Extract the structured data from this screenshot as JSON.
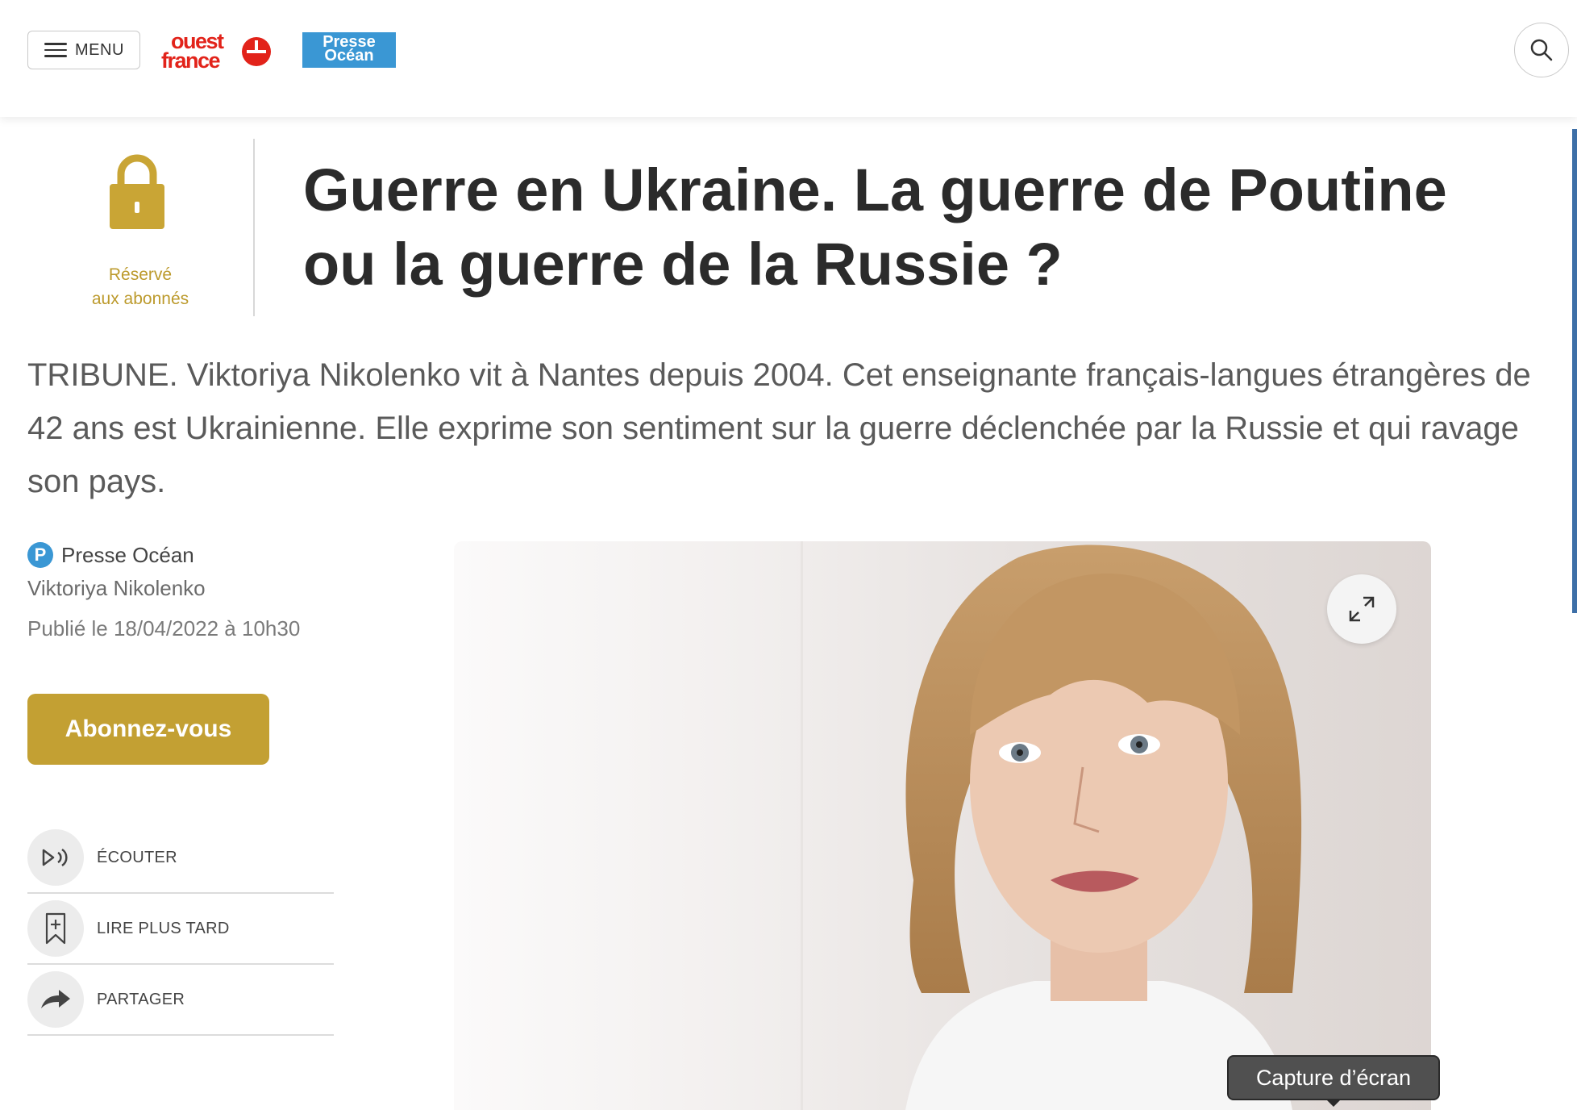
{
  "header": {
    "menu_label": "MENU",
    "logo_ouest_france": "ouest france",
    "logo_presse_ocean": "Presse Océan"
  },
  "badge": {
    "line1": "Réservé",
    "line2": "aux abonnés",
    "color": "#bc9a2c"
  },
  "article": {
    "title": "Guerre en Ukraine. La guerre de Poutine ou la guerre de la Russie ?",
    "lead": "TRIBUNE. Viktoriya Nikolenko vit à Nantes depuis 2004. Cet enseignante français-langues étrangères de 42 ans est Ukrainienne. Elle exprime son sentiment sur la guerre déclenchée par la Russie et qui ravage son pays.",
    "source": "Presse Océan",
    "source_icon_letter": "P",
    "author": "Viktoriya Nikolenko",
    "published": "Publié le 18/04/2022 à 10h30"
  },
  "subscribe_label": "Abonnez-vous",
  "actions": [
    {
      "label": "ÉCOUTER",
      "icon": "play-audio-icon"
    },
    {
      "label": "LIRE PLUS TARD",
      "icon": "bookmark-add-icon"
    },
    {
      "label": "PARTAGER",
      "icon": "share-arrow-icon"
    }
  ],
  "tooltip": "Capture d’écran",
  "colors": {
    "accent_gold": "#c3a033",
    "ouest_france_red": "#e2231a",
    "presse_ocean_blue": "#3a97d4"
  }
}
